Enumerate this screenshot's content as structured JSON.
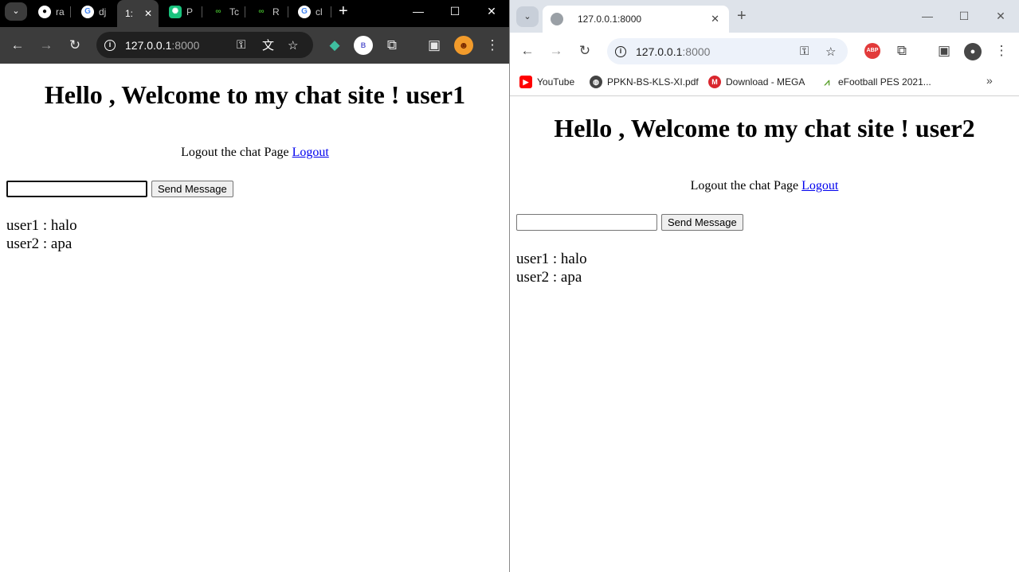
{
  "left_window": {
    "tabs": [
      {
        "label": "ra",
        "icon": "github-icon"
      },
      {
        "label": "dj",
        "icon": "google-icon"
      },
      {
        "label": "1:",
        "icon": "none",
        "active": true
      },
      {
        "label": "P",
        "icon": "chatgpt-icon"
      },
      {
        "label": "Tc",
        "icon": "infinity-icon"
      },
      {
        "label": "R",
        "icon": "infinity-icon"
      },
      {
        "label": "cl",
        "icon": "google-icon"
      }
    ],
    "address_host": "127.0.0.1",
    "address_port": ":8000",
    "profile_letter": "B",
    "page": {
      "heading": "Hello , Welcome to my chat site ! user1",
      "logout_prompt": "Logout the chat Page",
      "logout_link": "Logout",
      "input_value": "",
      "send_button": "Send Message",
      "messages": [
        "user1 : halo",
        "user2 : apa"
      ]
    }
  },
  "right_window": {
    "tab_title": "127.0.0.1:8000",
    "address_host": "127.0.0.1",
    "address_port": ":8000",
    "extension_badge": "ABP",
    "bookmarks": [
      {
        "label": "YouTube",
        "icon": "youtube-icon",
        "color": "#ff0000"
      },
      {
        "label": "PPKN-BS-KLS-XI.pdf",
        "icon": "globe-icon",
        "color": "#444444"
      },
      {
        "label": "Download - MEGA",
        "icon": "mega-icon",
        "color": "#d9272e"
      },
      {
        "label": "eFootball PES 2021...",
        "icon": "efootball-icon",
        "color": "#5aa02c"
      }
    ],
    "page": {
      "heading": "Hello , Welcome to my chat site ! user2",
      "logout_prompt": "Logout the chat Page",
      "logout_link": "Logout",
      "input_value": "",
      "send_button": "Send Message",
      "messages": [
        "user1 : halo",
        "user2 : apa"
      ]
    }
  },
  "colors": {
    "link": "#0000ee",
    "dark_chrome": "#3c3c3c",
    "light_chrome": "#dee3ea"
  }
}
